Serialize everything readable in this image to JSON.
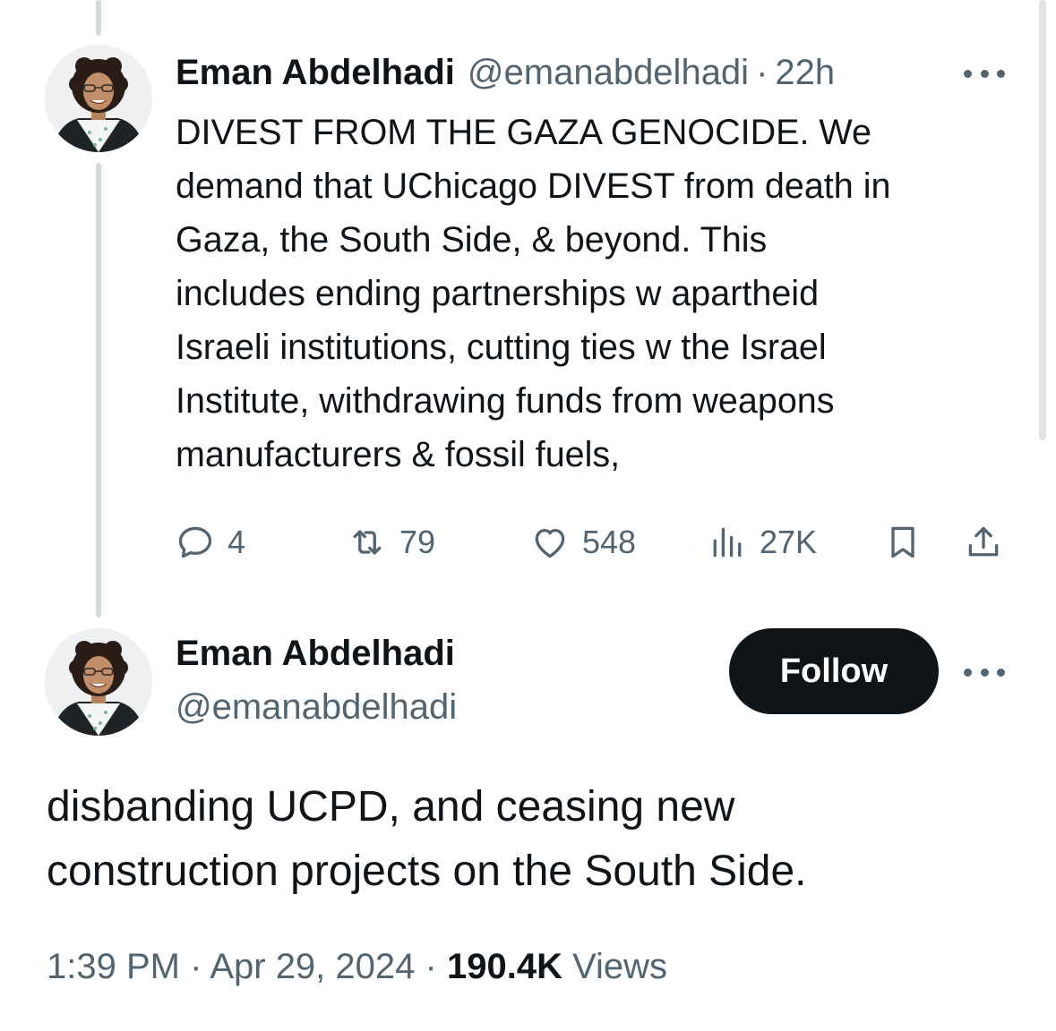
{
  "tweet1": {
    "author": {
      "display_name": "Eman Abdelhadi",
      "handle": "@emanabdelhadi",
      "avatar": "profile-photo"
    },
    "time_ago": "22h",
    "separator": "·",
    "more_icon": "more-horizontal-icon",
    "text": "DIVEST FROM THE GAZA GENOCIDE. We\ndemand that UChicago DIVEST from death in\nGaza, the South Side, & beyond. This\nincludes ending partnerships w apartheid\nIsraeli institutions, cutting ties w the Israel\nInstitute, withdrawing funds from weapons\nmanufacturers & fossil fuels,",
    "actions": {
      "replies": "4",
      "reposts": "79",
      "likes": "548",
      "views": "27K",
      "icons": [
        "reply-icon",
        "retweet-icon",
        "like-icon",
        "views-icon",
        "bookmark-icon",
        "share-icon"
      ]
    }
  },
  "tweet2": {
    "author": {
      "display_name": "Eman Abdelhadi",
      "handle": "@emanabdelhadi",
      "avatar": "profile-photo"
    },
    "follow_label": "Follow",
    "more_icon": "more-horizontal-icon",
    "text": "disbanding UCPD, and ceasing new\nconstruction projects on the South Side.",
    "time": "1:39 PM",
    "separator": "·",
    "date": "Apr 29, 2024",
    "views_count": "190.4K",
    "views_label": "Views"
  },
  "colors": {
    "text_primary": "#0f1419",
    "text_secondary": "#536471",
    "thread_line": "#cfd9de",
    "follow_bg": "#0f1419",
    "follow_text": "#ffffff"
  }
}
